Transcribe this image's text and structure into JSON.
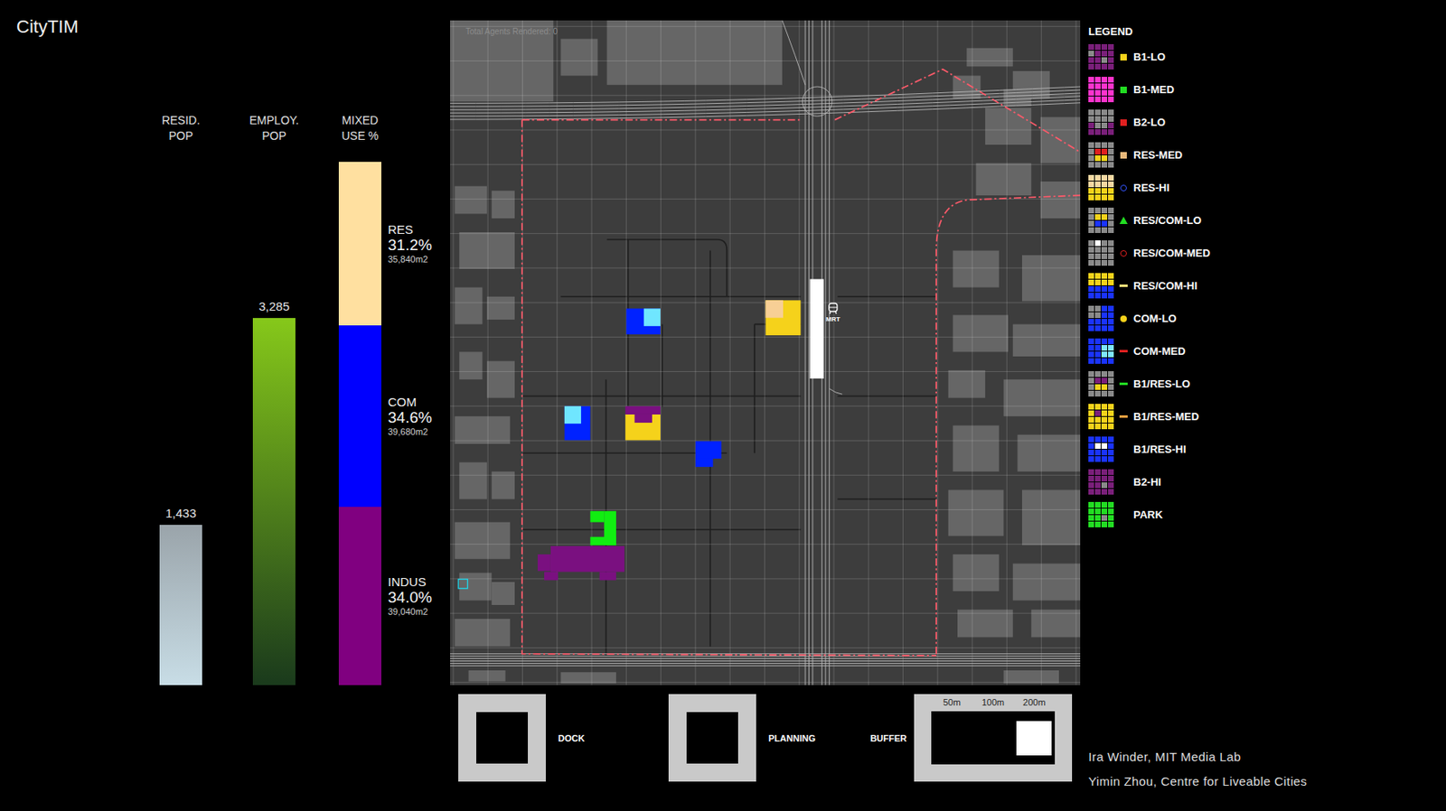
{
  "app": {
    "title": "CityTIM"
  },
  "indicators": [
    {
      "label": "RESID. POP",
      "value": "1,433",
      "level": 0.305
    },
    {
      "label": "EMPLOY. POP",
      "value": "3,285",
      "level": 0.7
    }
  ],
  "mixed_use": {
    "label": "MIXED USE %",
    "segments": [
      {
        "name": "RES",
        "percent": "31.2%",
        "area": "35,840m2",
        "level": 0.312,
        "color": "#ffe0a0"
      },
      {
        "name": "COM",
        "percent": "34.6%",
        "area": "39,680m2",
        "level": 0.346,
        "color": "#0000ff"
      },
      {
        "name": "INDUS",
        "percent": "34.0%",
        "area": "39,040m2",
        "level": 0.34,
        "color": "#800080"
      }
    ]
  },
  "map": {
    "agents": "Total Agents Rendered: 0",
    "station": "MRT",
    "patches": [
      {
        "color": "#0022ff"
      },
      {
        "color": "#6fe6ff"
      },
      {
        "color": "#f5d21b"
      },
      {
        "color": "#f7cf95"
      },
      {
        "color": "#0022ff"
      },
      {
        "color": "#6fe6ff"
      },
      {
        "color": "#f5d21b"
      },
      {
        "color": "#7a1080"
      },
      {
        "color": "#0022ff"
      },
      {
        "color": "#11ee11"
      },
      {
        "color": "#7a1080"
      },
      {
        "color": "#22d3e6"
      }
    ]
  },
  "legend": {
    "title": "LEGEND",
    "items": [
      {
        "label": "B1-LO",
        "kind": "square",
        "color": "#f5d21b"
      },
      {
        "label": "B1-MED",
        "kind": "square",
        "color": "#22dd22"
      },
      {
        "label": "B2-LO",
        "kind": "square",
        "color": "#e02020"
      },
      {
        "label": "RES-MED",
        "kind": "square",
        "color": "#e8b87a"
      },
      {
        "label": "RES-HI",
        "kind": "ring",
        "color": "#3355ff"
      },
      {
        "label": "RES/COM-LO",
        "kind": "triangle",
        "color": "#22dd22"
      },
      {
        "label": "RES/COM-MED",
        "kind": "ring",
        "color": "#e02020"
      },
      {
        "label": "RES/COM-HI",
        "kind": "dash",
        "color": "#f5e07a"
      },
      {
        "label": "COM-LO",
        "kind": "dot",
        "color": "#f5d21b"
      },
      {
        "label": "COM-MED",
        "kind": "dash",
        "color": "#e02020"
      },
      {
        "label": "B1/RES-LO",
        "kind": "dash",
        "color": "#22dd22"
      },
      {
        "label": "B1/RES-MED",
        "kind": "dash",
        "color": "#f0a040"
      },
      {
        "label": "B1/RES-HI",
        "kind": "none"
      },
      {
        "label": "B2-HI",
        "kind": "none"
      },
      {
        "label": "PARK",
        "kind": "none"
      }
    ]
  },
  "controls": [
    {
      "label": "DOCK"
    },
    {
      "label": "PLANNING"
    }
  ],
  "buffer": {
    "label": "BUFFER",
    "options": [
      {
        "label": "50m",
        "selected": false
      },
      {
        "label": "100m",
        "selected": false
      },
      {
        "label": "200m",
        "selected": true
      }
    ]
  },
  "credits": [
    "Ira Winder, MIT Media Lab",
    "Yimin Zhou, Centre for Liveable Cities"
  ]
}
